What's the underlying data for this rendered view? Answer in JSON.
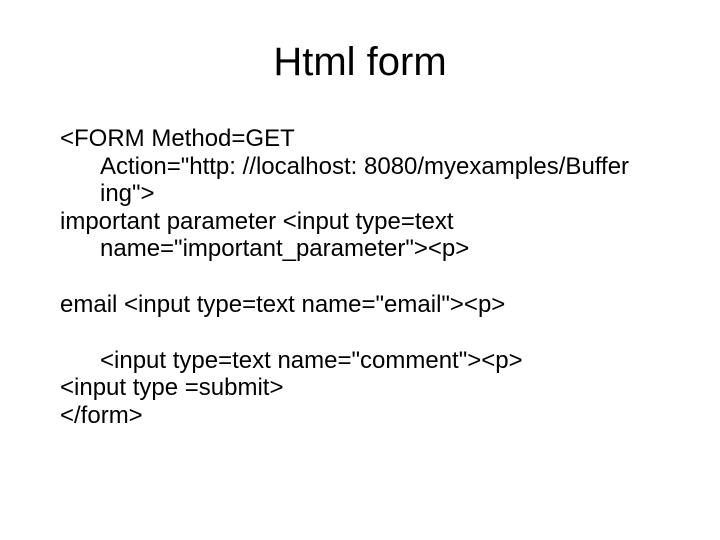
{
  "title": "Html form",
  "lines": {
    "l1": "<FORM Method=GET",
    "l2": "Action=\"http: //localhost: 8080/myexamples/Buffer",
    "l3": "ing\">",
    "l4": "important parameter <input type=text",
    "l5": "name=\"important_parameter\"><p>",
    "l6": "email <input type=text name=\"email\"><p>",
    "l7": "<input type=text name=\"comment\"><p>",
    "l8": "<input type =submit>",
    "l9": "</form>"
  }
}
